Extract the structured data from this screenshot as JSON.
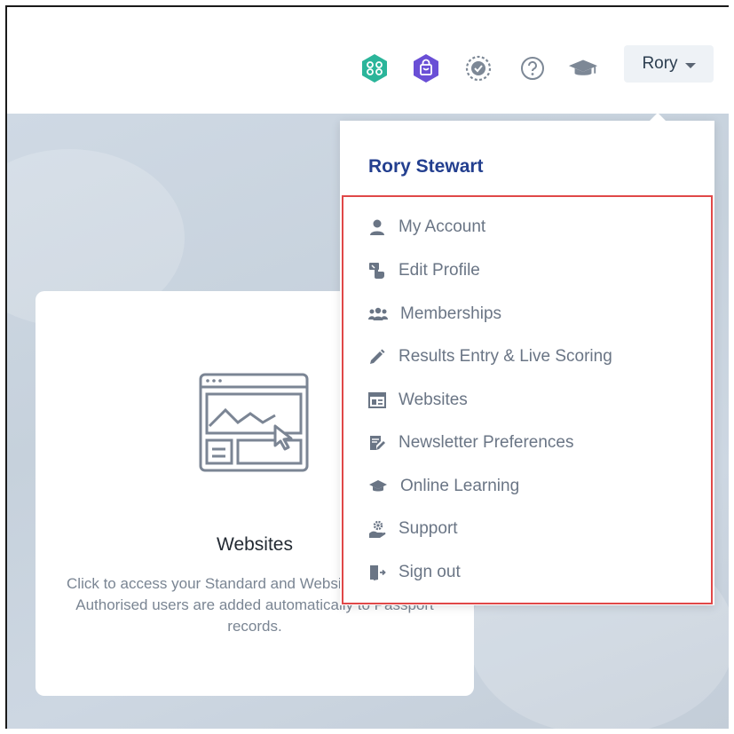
{
  "header": {
    "icons": [
      {
        "name": "community-icon",
        "color": "#2bb59a"
      },
      {
        "name": "shop-bag-icon",
        "color": "#6a4fd6"
      },
      {
        "name": "progress-check-icon",
        "color": "#7d8896"
      },
      {
        "name": "help-icon",
        "color": "#7d8896"
      },
      {
        "name": "graduation-cap-icon",
        "color": "#7d8896"
      }
    ],
    "user_button_label": "Rory"
  },
  "dropdown": {
    "full_name": "Rory Stewart",
    "items": [
      {
        "label": "My Account",
        "icon": "user-icon"
      },
      {
        "label": "Edit Profile",
        "icon": "edit-profile-icon"
      },
      {
        "label": "Memberships",
        "icon": "users-group-icon"
      },
      {
        "label": "Results Entry & Live Scoring",
        "icon": "pencil-icon"
      },
      {
        "label": "Websites",
        "icon": "website-layout-icon"
      },
      {
        "label": "Newsletter Preferences",
        "icon": "newsletter-icon"
      },
      {
        "label": "Online Learning",
        "icon": "graduation-cap-icon"
      },
      {
        "label": "Support",
        "icon": "support-icon"
      },
      {
        "label": "Sign out",
        "icon": "sign-out-icon"
      }
    ],
    "highlight_color": "#e04848",
    "name_color": "#233f8f"
  },
  "card": {
    "title": "Websites",
    "description": "Click to access your Standard and Website permissions. Authorised users are added automatically to Passport records."
  }
}
